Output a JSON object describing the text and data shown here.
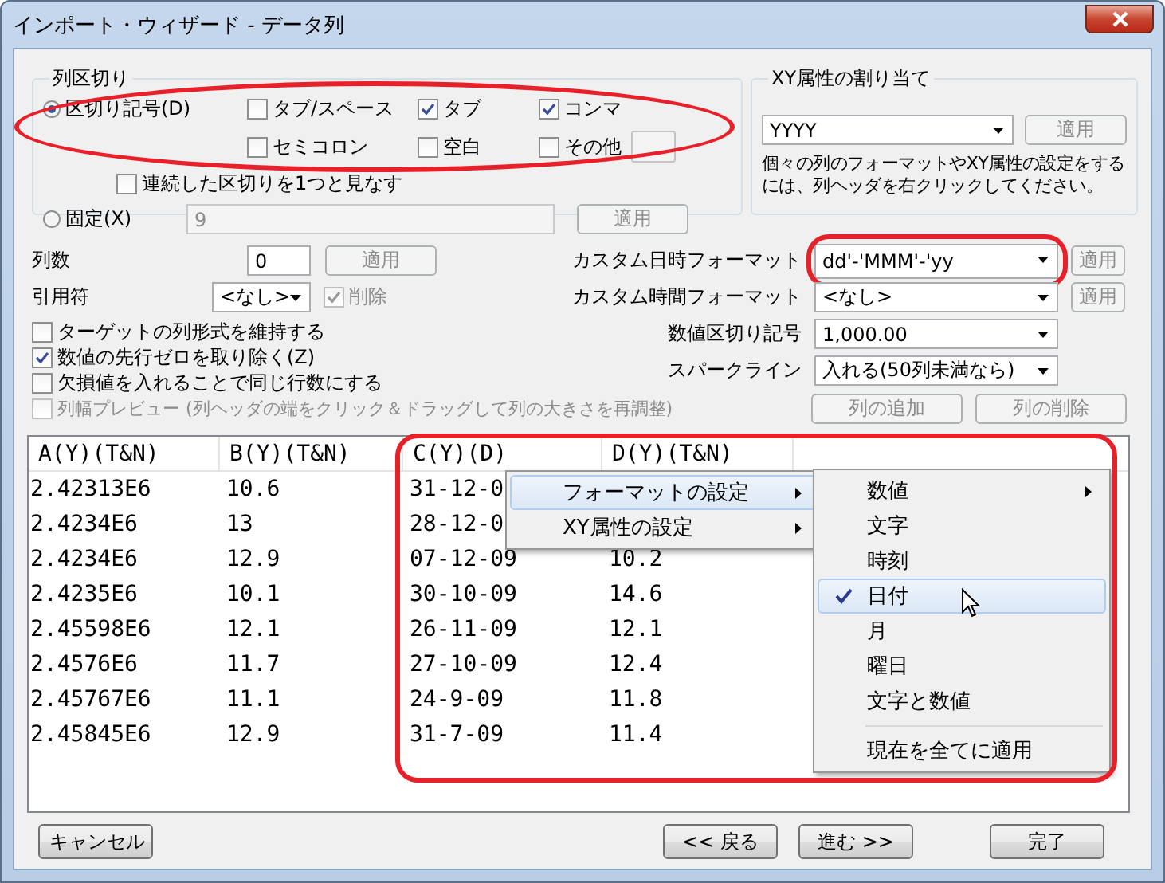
{
  "window": {
    "title": "インポート・ウィザード - データ列"
  },
  "column_separator": {
    "title": "列区切り",
    "delimited": {
      "label": "区切り記号(D)",
      "selected": true
    },
    "delimiters": [
      {
        "label": "タブ/スペース",
        "checked": false
      },
      {
        "label": "タブ",
        "checked": true
      },
      {
        "label": "コンマ",
        "checked": true
      },
      {
        "label": "セミコロン",
        "checked": false
      },
      {
        "label": "空白",
        "checked": false
      },
      {
        "label": "その他",
        "checked": false
      }
    ],
    "merge_delimiters": {
      "label": "連続した区切りを1つと見なす",
      "checked": false
    },
    "fixed": {
      "label": "固定(X)",
      "selected": false,
      "value": "9",
      "apply": {
        "label": "適用",
        "disabled": true
      }
    }
  },
  "xy_assignment": {
    "title": "XY属性の割り当て",
    "value": "YYYY",
    "apply": {
      "label": "適用",
      "disabled": true
    },
    "hint": "個々の列のフォーマットやXY属性の設定をするには、列ヘッダを右クリックしてください。"
  },
  "column_count": {
    "label": "列数",
    "value": "0",
    "apply": {
      "label": "適用",
      "disabled": true
    }
  },
  "quote": {
    "label": "引用符",
    "value": "<なし>",
    "remove": {
      "label": "削除",
      "checked": true,
      "disabled": true
    }
  },
  "options": [
    {
      "label": "ターゲットの列形式を維持する",
      "checked": false,
      "disabled": false
    },
    {
      "label": "数値の先行ゼロを取り除く(Z)",
      "checked": true,
      "disabled": false
    },
    {
      "label": "欠損値を入れることで同じ行数にする",
      "checked": false,
      "disabled": false
    },
    {
      "label": "列幅プレビュー (列ヘッダの端をクリック＆ドラッグして列の大きさを再調整)",
      "checked": false,
      "disabled": true
    }
  ],
  "formats": [
    {
      "label": "カスタム日時フォーマット",
      "value": "dd'-'MMM'-'yy",
      "apply": {
        "label": "適用",
        "disabled": true
      }
    },
    {
      "label": "カスタム時間フォーマット",
      "value": "<なし>",
      "apply": {
        "label": "適用",
        "disabled": true
      }
    },
    {
      "label": "数値区切り記号",
      "value": "1,000.00"
    },
    {
      "label": "スパークライン",
      "value": "入れる(50列未満なら)"
    }
  ],
  "column_buttons": [
    {
      "label": "列の追加",
      "disabled": true
    },
    {
      "label": "列の削除",
      "disabled": true
    }
  ],
  "table": {
    "columns": [
      "A(Y)(T&N)",
      "B(Y)(T&N)",
      "C(Y)(D)",
      "D(Y)(T&N)"
    ],
    "rows": [
      [
        "2.42313E6",
        "10.6",
        "31-12-0",
        null
      ],
      [
        "2.4234E6",
        "13",
        "28-12-0",
        null
      ],
      [
        "2.4234E6",
        "12.9",
        "07-12-09",
        "10.2"
      ],
      [
        "2.4235E6",
        "10.1",
        "30-10-09",
        "14.6"
      ],
      [
        "2.45598E6",
        "12.1",
        "26-11-09",
        "12.1"
      ],
      [
        "2.4576E6",
        "11.7",
        "27-10-09",
        "12.4"
      ],
      [
        "2.45767E6",
        "11.1",
        "24-9-09",
        "11.8"
      ],
      [
        "2.45845E6",
        "12.9",
        "31-7-09",
        "11.4"
      ]
    ]
  },
  "context_menu": {
    "items": [
      {
        "label": "フォーマットの設定",
        "selected": true,
        "has_submenu": true
      },
      {
        "label": "XY属性の設定",
        "selected": false,
        "has_submenu": true
      }
    ]
  },
  "submenu": {
    "items": [
      {
        "kind": "item",
        "label": "数値",
        "checked": false,
        "selected": false,
        "has_submenu": true
      },
      {
        "kind": "item",
        "label": "文字",
        "checked": false,
        "selected": false,
        "has_submenu": false
      },
      {
        "kind": "item",
        "label": "時刻",
        "checked": false,
        "selected": false,
        "has_submenu": false
      },
      {
        "kind": "item",
        "label": "日付",
        "checked": true,
        "selected": true,
        "has_submenu": false
      },
      {
        "kind": "item",
        "label": "月",
        "checked": false,
        "selected": false,
        "has_submenu": false
      },
      {
        "kind": "item",
        "label": "曜日",
        "checked": false,
        "selected": false,
        "has_submenu": false
      },
      {
        "kind": "item",
        "label": "文字と数値",
        "checked": false,
        "selected": false,
        "has_submenu": false
      },
      {
        "kind": "separator"
      },
      {
        "kind": "item",
        "label": "現在を全てに適用",
        "checked": false,
        "selected": false,
        "has_submenu": false
      }
    ]
  },
  "buttons": [
    {
      "label": "キャンセル"
    },
    {
      "label": "<< 戻る"
    },
    {
      "label": "進む >>"
    },
    {
      "label": "完了"
    }
  ]
}
